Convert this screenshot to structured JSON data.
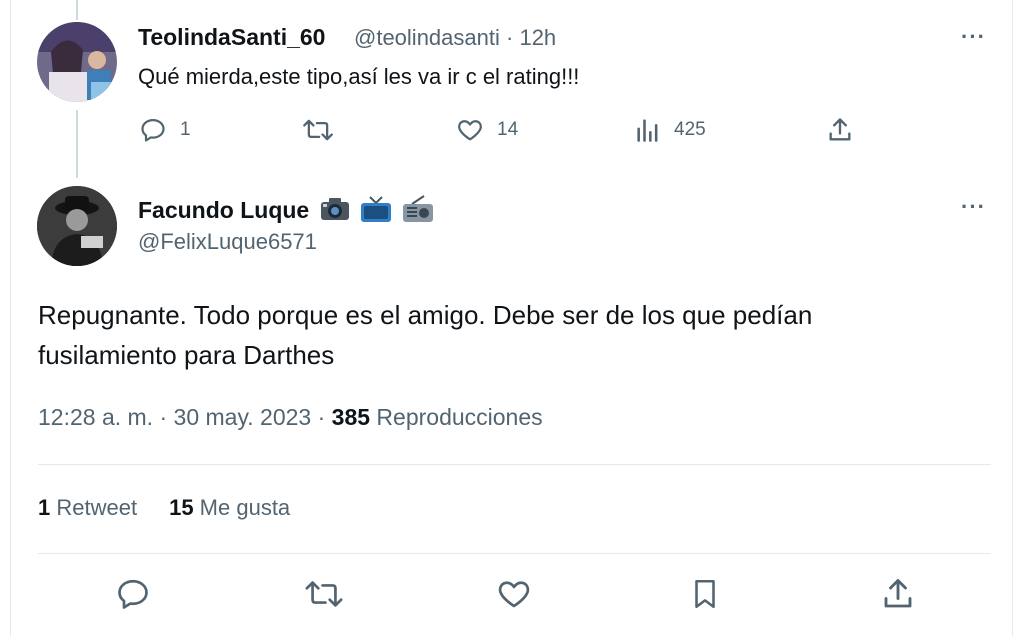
{
  "reply_tweet": {
    "display_name": "TeolindaSanti_60",
    "handle": "@teolindasanti",
    "separator": "·",
    "time": "12h",
    "text": "Qué  mierda,este tipo,así  les va ir c el rating!!!",
    "replies": "1",
    "retweets": "",
    "likes": "14",
    "views": "425"
  },
  "main_tweet": {
    "display_name": "Facundo Luque",
    "name_emojis": [
      "camera-icon",
      "tv-icon",
      "radio-icon"
    ],
    "handle": "@FelixLuque6571",
    "text_line1": "Repugnante. Todo porque es el amigo. Debe ser de los que pedían",
    "text_line2": "fusilamiento para Darthes",
    "time": "12:28 a. m.",
    "dot1": " · ",
    "date": "30 may. 2023",
    "dot2": " · ",
    "views": "385",
    "views_label": " Reproducciones",
    "retweet_count": "1",
    "retweet_label": " Retweet",
    "like_count": "15",
    "like_label": " Me gusta"
  },
  "icons": {
    "more": "more-icon",
    "reply": "reply-icon",
    "retweet": "retweet-icon",
    "like": "heart-icon",
    "views": "views-icon",
    "share": "share-icon",
    "bookmark": "bookmark-icon"
  },
  "colors": {
    "text_primary": "#0f1419",
    "text_secondary": "#536471",
    "divider": "#e6e9eb",
    "thread_line": "#cfd9de"
  }
}
